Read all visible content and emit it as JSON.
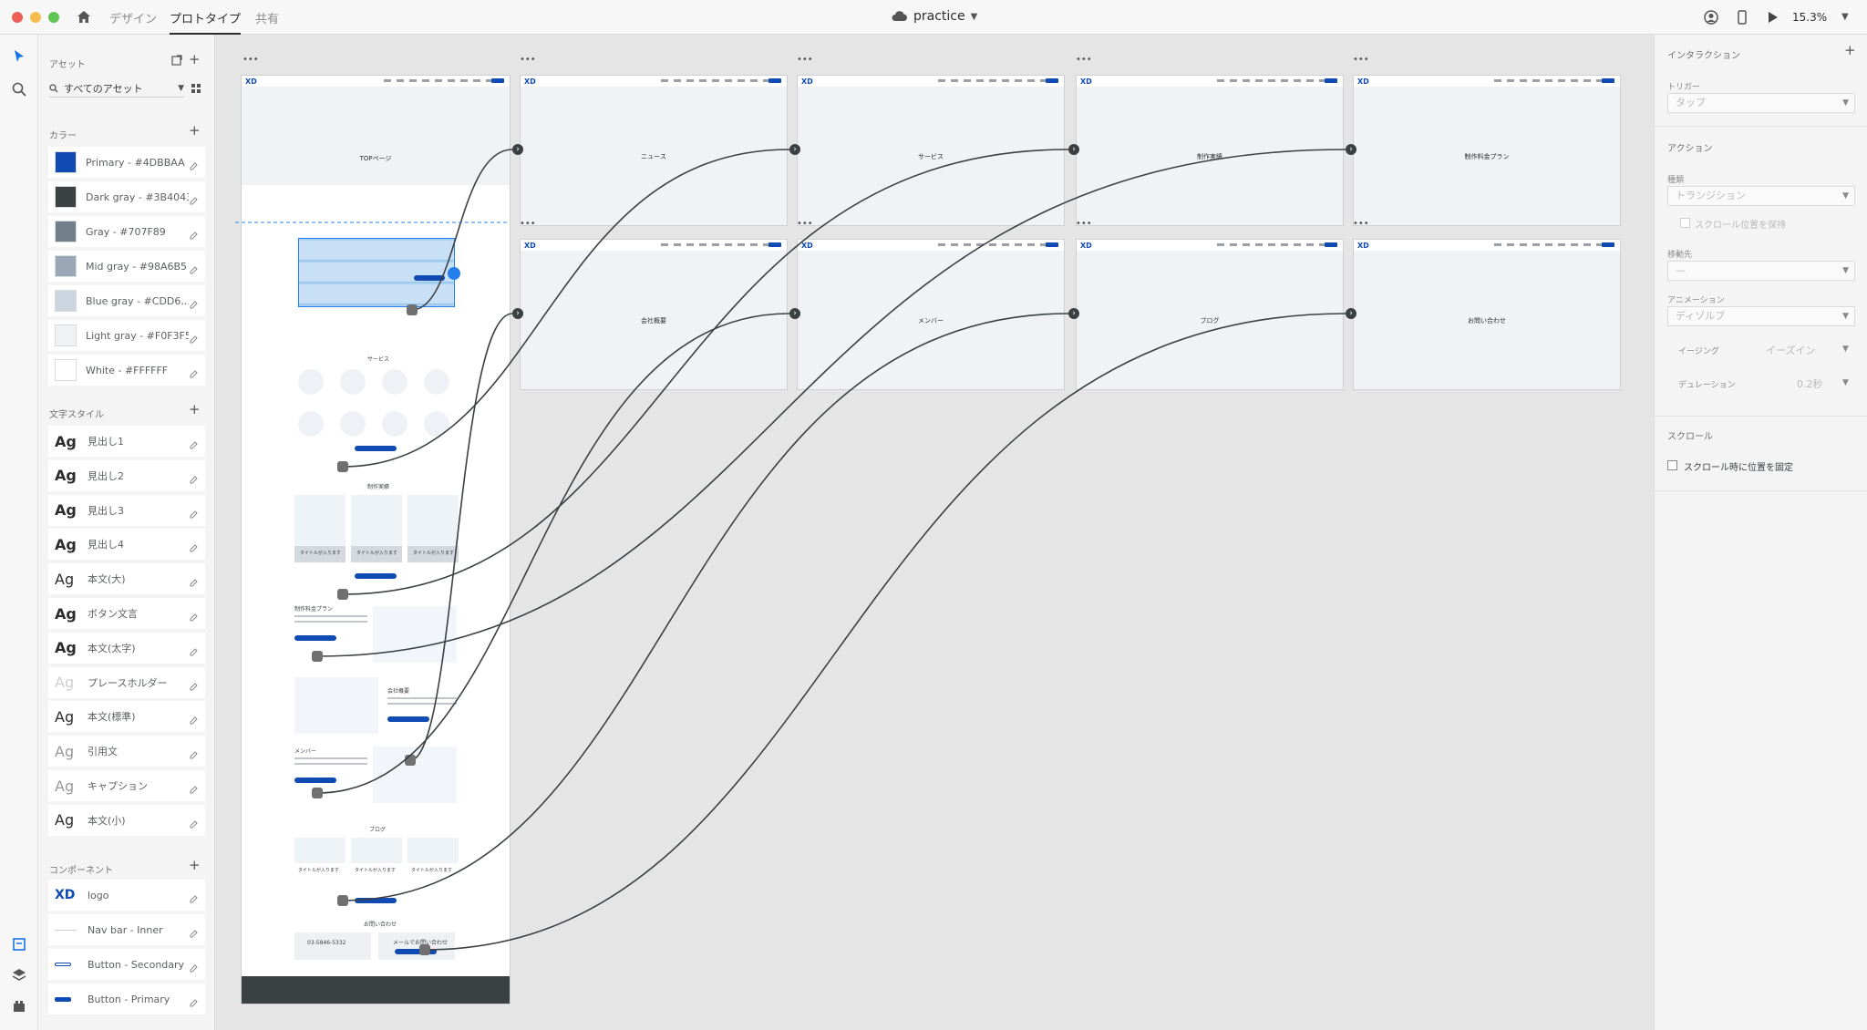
{
  "topbar": {
    "tabs": [
      "デザイン",
      "プロトタイプ",
      "共有"
    ],
    "doc_title": "practice",
    "zoom": "15.3%"
  },
  "assets": {
    "title": "アセット",
    "search": "すべてのアセット",
    "colors_title": "カラー",
    "colors": [
      {
        "label": "Primary - #4DBBAA",
        "hex": "#0f4bb3"
      },
      {
        "label": "Dark gray - #3B4043",
        "hex": "#3b4043"
      },
      {
        "label": "Gray - #707F89",
        "hex": "#707f89"
      },
      {
        "label": "Mid gray - #98A6B5",
        "hex": "#98a6b5"
      },
      {
        "label": "Blue gray - #CDD6...",
        "hex": "#cdd6e0"
      },
      {
        "label": "Light gray - #F0F3F5",
        "hex": "#f0f3f5"
      },
      {
        "label": "White - #FFFFFF",
        "hex": "#ffffff"
      }
    ],
    "text_title": "文字スタイル",
    "text_styles": [
      {
        "label": "見出し1",
        "tone": "bold"
      },
      {
        "label": "見出し2",
        "tone": "bold"
      },
      {
        "label": "見出し3",
        "tone": "bold"
      },
      {
        "label": "見出し4",
        "tone": "bold"
      },
      {
        "label": "本文(大)",
        "tone": "reg"
      },
      {
        "label": "ボタン文言",
        "tone": "bold"
      },
      {
        "label": "本文(太字)",
        "tone": "bold"
      },
      {
        "label": "プレースホルダー",
        "tone": "light"
      },
      {
        "label": "本文(標準)",
        "tone": "reg"
      },
      {
        "label": "引用文",
        "tone": "mid"
      },
      {
        "label": "キャプション",
        "tone": "mid"
      },
      {
        "label": "本文(小)",
        "tone": "reg"
      }
    ],
    "components_title": "コンポーネント",
    "components": [
      {
        "label": "logo"
      },
      {
        "label": "Nav bar - Inner"
      },
      {
        "label": "Button - Secondary"
      },
      {
        "label": "Button - Primary"
      }
    ]
  },
  "canvas": {
    "top_page": {
      "title": "TOPページ",
      "sections": [
        "サービス",
        "制作実績",
        "制作料金プラン",
        "会社概要",
        "メンバー",
        "ブログ",
        "お問い合わせ"
      ],
      "card_title": "タイトルが入ります",
      "phone": "03-5846-5332",
      "mail": "メールでお問い合わせ"
    },
    "artboards": [
      "ニュース",
      "サービス",
      "制作実績",
      "制作料金プラン",
      "会社概要",
      "メンバー",
      "ブログ",
      "お問い合わせ"
    ],
    "logo_text": "XD"
  },
  "inspector": {
    "title": "インタラクション",
    "trigger_label": "トリガー",
    "trigger_value": "タップ",
    "action_title": "アクション",
    "type_label": "種類",
    "type_value": "トランジション",
    "keep_scroll": "スクロール位置を保持",
    "dest_label": "移動先",
    "dest_value": "—",
    "anim_label": "アニメーション",
    "anim_value": "ディゾルブ",
    "easing_label": "イージング",
    "easing_value": "イーズイン",
    "duration_label": "デュレーション",
    "duration_value": "0.2秒",
    "scroll_title": "スクロール",
    "fix_scroll": "スクロール時に位置を固定"
  }
}
